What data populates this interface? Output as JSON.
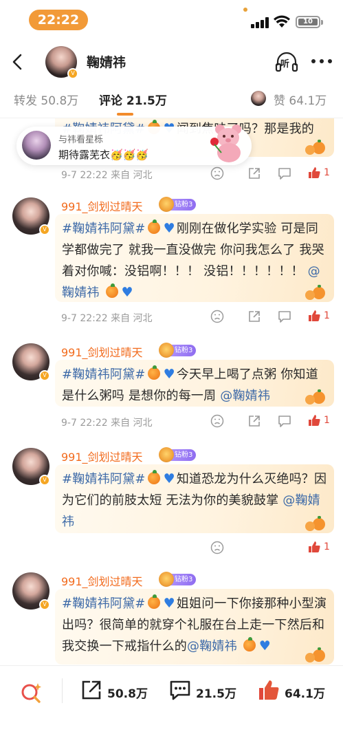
{
  "status_bar": {
    "time": "22:22",
    "battery": "10"
  },
  "header": {
    "back_label": "返回",
    "title": "鞠婧祎",
    "listen_label": "听"
  },
  "tabs": {
    "repost": "转发 50.8万",
    "comment": "评论 21.5万",
    "like": "赞 64.1万"
  },
  "popup": {
    "line1": "与祎看星栎",
    "line2": "期待露芜衣🥳🥳🥳"
  },
  "comments": [
    {
      "text_tag": "#鞠婧祎阿黛#",
      "text_body": "闻到焦味了吗？那是我的",
      "time": "9-7 22:22 来自 河北",
      "likes": "1"
    },
    {
      "author": "991_剑划过晴天",
      "badge": "钻粉3",
      "text_tag": "#鞠婧祎阿黛#",
      "text_body": "刚刚在做化学实验 可是同学都做完了 就我一直没做完 你问我怎么了 我哭着对你喊：没铝啊！！！ 没铝！！！！！！ ",
      "mention": "@鞠婧祎",
      "time": "9-7 22:22 来自 河北",
      "likes": "1"
    },
    {
      "author": "991_剑划过晴天",
      "badge": "钻粉3",
      "text_tag": "#鞠婧祎阿黛#",
      "text_body": "今天早上喝了点粥 你知道是什么粥吗 是想你的每一周 ",
      "mention": "@鞠婧祎",
      "time": "9-7 22:22 来自 河北",
      "likes": "1"
    },
    {
      "author": "991_剑划过晴天",
      "badge": "钻粉3",
      "text_tag": "#鞠婧祎阿黛#",
      "text_body": "知道恐龙为什么灭绝吗？因为它们的前肢太短 无法为你的美貌鼓掌 ",
      "mention": "@鞠婧祎",
      "time": "",
      "likes": "1"
    },
    {
      "author": "991_剑划过晴天",
      "badge": "钻粉3",
      "text_tag": "#鞠婧祎阿黛#",
      "text_body": "姐姐问一下你接那种小型演出吗？很简单的就穿个礼服在台上走一下然后和我交换一下戒指什么的",
      "mention": "@鞠婧祎"
    }
  ],
  "bottom_bar": {
    "search_icon": "search-sparkle-icon",
    "repost": "50.8万",
    "comment": "21.5万",
    "like": "64.1万"
  },
  "colors": {
    "accent": "#f28b2b",
    "name": "#f26b1d",
    "link": "#3d6aa8",
    "like_red": "#e0483b"
  }
}
